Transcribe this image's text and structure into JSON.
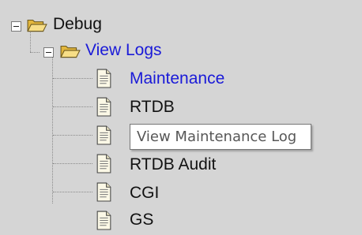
{
  "tree": {
    "root": {
      "label": "Debug",
      "icon": "folder-open-icon",
      "expander": "minus"
    },
    "group": {
      "label": "View Logs",
      "icon": "folder-open-icon",
      "expander": "minus"
    },
    "items": [
      {
        "label": "Maintenance",
        "icon": "document-icon",
        "color": "#1a1ad8"
      },
      {
        "label": "RTDB",
        "icon": "document-icon",
        "color": "#111111"
      },
      {
        "label": "",
        "icon": "document-icon",
        "color": "#111111"
      },
      {
        "label": "RTDB Audit",
        "icon": "document-icon",
        "color": "#111111"
      },
      {
        "label": "CGI",
        "icon": "document-icon",
        "color": "#111111"
      },
      {
        "label": "GS",
        "icon": "document-icon",
        "color": "#111111"
      }
    ]
  },
  "tooltip": {
    "text": "View Maintenance Log"
  },
  "colors": {
    "background": "#d5d5d5",
    "link": "#1a1ad8",
    "folder": "#f3d36a"
  }
}
